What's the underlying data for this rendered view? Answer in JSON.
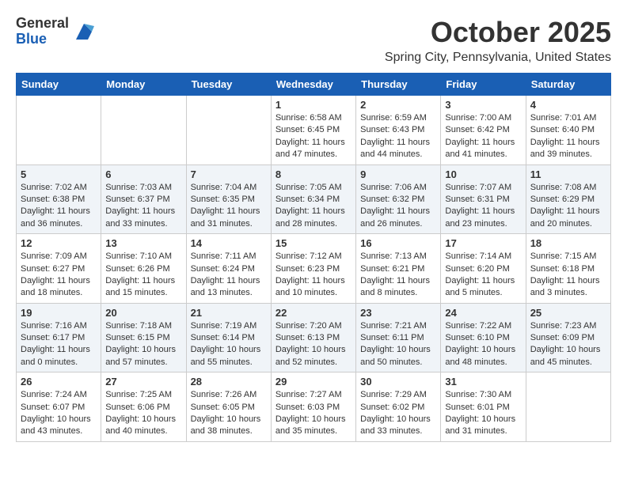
{
  "header": {
    "logo_general": "General",
    "logo_blue": "Blue",
    "title": "October 2025",
    "subtitle": "Spring City, Pennsylvania, United States"
  },
  "days": [
    "Sunday",
    "Monday",
    "Tuesday",
    "Wednesday",
    "Thursday",
    "Friday",
    "Saturday"
  ],
  "weeks": [
    [
      {
        "day": "",
        "content": ""
      },
      {
        "day": "",
        "content": ""
      },
      {
        "day": "",
        "content": ""
      },
      {
        "day": "1",
        "content": "Sunrise: 6:58 AM\nSunset: 6:45 PM\nDaylight: 11 hours and 47 minutes."
      },
      {
        "day": "2",
        "content": "Sunrise: 6:59 AM\nSunset: 6:43 PM\nDaylight: 11 hours and 44 minutes."
      },
      {
        "day": "3",
        "content": "Sunrise: 7:00 AM\nSunset: 6:42 PM\nDaylight: 11 hours and 41 minutes."
      },
      {
        "day": "4",
        "content": "Sunrise: 7:01 AM\nSunset: 6:40 PM\nDaylight: 11 hours and 39 minutes."
      }
    ],
    [
      {
        "day": "5",
        "content": "Sunrise: 7:02 AM\nSunset: 6:38 PM\nDaylight: 11 hours and 36 minutes."
      },
      {
        "day": "6",
        "content": "Sunrise: 7:03 AM\nSunset: 6:37 PM\nDaylight: 11 hours and 33 minutes."
      },
      {
        "day": "7",
        "content": "Sunrise: 7:04 AM\nSunset: 6:35 PM\nDaylight: 11 hours and 31 minutes."
      },
      {
        "day": "8",
        "content": "Sunrise: 7:05 AM\nSunset: 6:34 PM\nDaylight: 11 hours and 28 minutes."
      },
      {
        "day": "9",
        "content": "Sunrise: 7:06 AM\nSunset: 6:32 PM\nDaylight: 11 hours and 26 minutes."
      },
      {
        "day": "10",
        "content": "Sunrise: 7:07 AM\nSunset: 6:31 PM\nDaylight: 11 hours and 23 minutes."
      },
      {
        "day": "11",
        "content": "Sunrise: 7:08 AM\nSunset: 6:29 PM\nDaylight: 11 hours and 20 minutes."
      }
    ],
    [
      {
        "day": "12",
        "content": "Sunrise: 7:09 AM\nSunset: 6:27 PM\nDaylight: 11 hours and 18 minutes."
      },
      {
        "day": "13",
        "content": "Sunrise: 7:10 AM\nSunset: 6:26 PM\nDaylight: 11 hours and 15 minutes."
      },
      {
        "day": "14",
        "content": "Sunrise: 7:11 AM\nSunset: 6:24 PM\nDaylight: 11 hours and 13 minutes."
      },
      {
        "day": "15",
        "content": "Sunrise: 7:12 AM\nSunset: 6:23 PM\nDaylight: 11 hours and 10 minutes."
      },
      {
        "day": "16",
        "content": "Sunrise: 7:13 AM\nSunset: 6:21 PM\nDaylight: 11 hours and 8 minutes."
      },
      {
        "day": "17",
        "content": "Sunrise: 7:14 AM\nSunset: 6:20 PM\nDaylight: 11 hours and 5 minutes."
      },
      {
        "day": "18",
        "content": "Sunrise: 7:15 AM\nSunset: 6:18 PM\nDaylight: 11 hours and 3 minutes."
      }
    ],
    [
      {
        "day": "19",
        "content": "Sunrise: 7:16 AM\nSunset: 6:17 PM\nDaylight: 11 hours and 0 minutes."
      },
      {
        "day": "20",
        "content": "Sunrise: 7:18 AM\nSunset: 6:15 PM\nDaylight: 10 hours and 57 minutes."
      },
      {
        "day": "21",
        "content": "Sunrise: 7:19 AM\nSunset: 6:14 PM\nDaylight: 10 hours and 55 minutes."
      },
      {
        "day": "22",
        "content": "Sunrise: 7:20 AM\nSunset: 6:13 PM\nDaylight: 10 hours and 52 minutes."
      },
      {
        "day": "23",
        "content": "Sunrise: 7:21 AM\nSunset: 6:11 PM\nDaylight: 10 hours and 50 minutes."
      },
      {
        "day": "24",
        "content": "Sunrise: 7:22 AM\nSunset: 6:10 PM\nDaylight: 10 hours and 48 minutes."
      },
      {
        "day": "25",
        "content": "Sunrise: 7:23 AM\nSunset: 6:09 PM\nDaylight: 10 hours and 45 minutes."
      }
    ],
    [
      {
        "day": "26",
        "content": "Sunrise: 7:24 AM\nSunset: 6:07 PM\nDaylight: 10 hours and 43 minutes."
      },
      {
        "day": "27",
        "content": "Sunrise: 7:25 AM\nSunset: 6:06 PM\nDaylight: 10 hours and 40 minutes."
      },
      {
        "day": "28",
        "content": "Sunrise: 7:26 AM\nSunset: 6:05 PM\nDaylight: 10 hours and 38 minutes."
      },
      {
        "day": "29",
        "content": "Sunrise: 7:27 AM\nSunset: 6:03 PM\nDaylight: 10 hours and 35 minutes."
      },
      {
        "day": "30",
        "content": "Sunrise: 7:29 AM\nSunset: 6:02 PM\nDaylight: 10 hours and 33 minutes."
      },
      {
        "day": "31",
        "content": "Sunrise: 7:30 AM\nSunset: 6:01 PM\nDaylight: 10 hours and 31 minutes."
      },
      {
        "day": "",
        "content": ""
      }
    ]
  ]
}
